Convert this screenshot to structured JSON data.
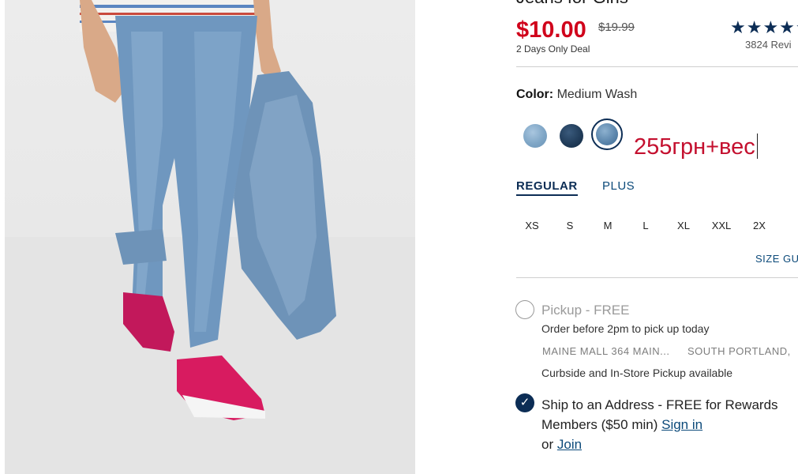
{
  "product": {
    "title": "Jeans for Girls",
    "price_sale": "$10.00",
    "price_original": "$19.99",
    "deal_note": "2 Days Only Deal",
    "rating_stars": "★★★★★",
    "review_count": "3824 Revi"
  },
  "color": {
    "label": "Color:",
    "value": "Medium Wash",
    "swatches": [
      "light-wash",
      "dark-wash",
      "medium-wash"
    ],
    "selected": "medium-wash"
  },
  "overlay_text": "255грн+вес",
  "fit": {
    "tabs": [
      {
        "label": "REGULAR"
      },
      {
        "label": "PLUS"
      }
    ],
    "selected": "REGULAR"
  },
  "sizes": [
    "XS",
    "S",
    "M",
    "L",
    "XL",
    "XXL",
    "2X"
  ],
  "size_guide": "SIZE GU",
  "fulfillment": {
    "pickup": {
      "title": "Pickup - FREE",
      "order_note": "Order before 2pm to pick up today",
      "store_name": "MAINE MALL 364 MAIN...",
      "store_city": "SOUTH PORTLAND,",
      "availability": "Curbside and In-Store Pickup available"
    },
    "ship": {
      "text_before": "Ship to an Address - FREE for Rewards Members ($50 min)",
      "sign_in": "Sign in",
      "or": "or",
      "join": "Join"
    },
    "selected": "ship"
  }
}
